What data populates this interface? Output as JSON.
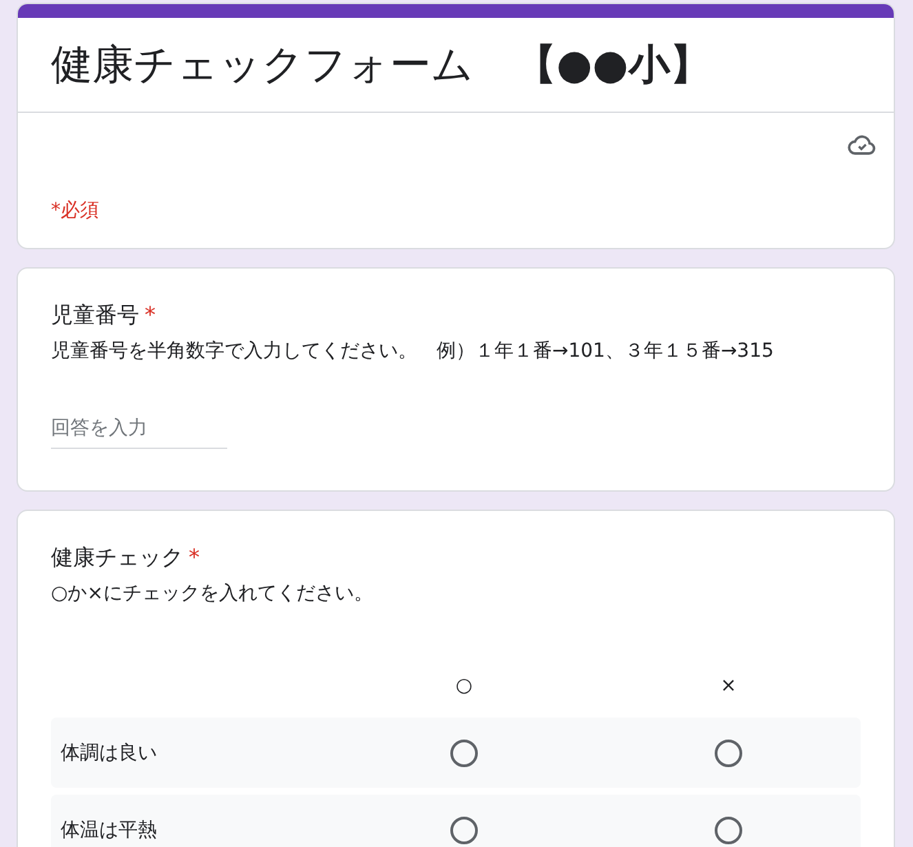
{
  "header": {
    "title": "健康チェックフォーム　**【●●小】**",
    "required_note": "*必須"
  },
  "questions": [
    {
      "kind": "short_answer",
      "title": "児童番号",
      "required_mark": "*",
      "description": "児童番号を半角数字で入力してください。　例）１年１番→101、３年１５番→315",
      "placeholder": "回答を入力"
    },
    {
      "kind": "grid",
      "title": "健康チェック",
      "required_mark": "*",
      "description": "○か×にチェックを入れてください。",
      "columns": [
        "○",
        "×"
      ],
      "rows": [
        {
          "label": "体調は良い",
          "options": [
            {
              "selected": false
            },
            {
              "selected": false
            }
          ]
        },
        {
          "label": "体温は平熱",
          "options": [
            {
              "selected": false
            },
            {
              "selected": false
            }
          ]
        }
      ]
    }
  ]
}
